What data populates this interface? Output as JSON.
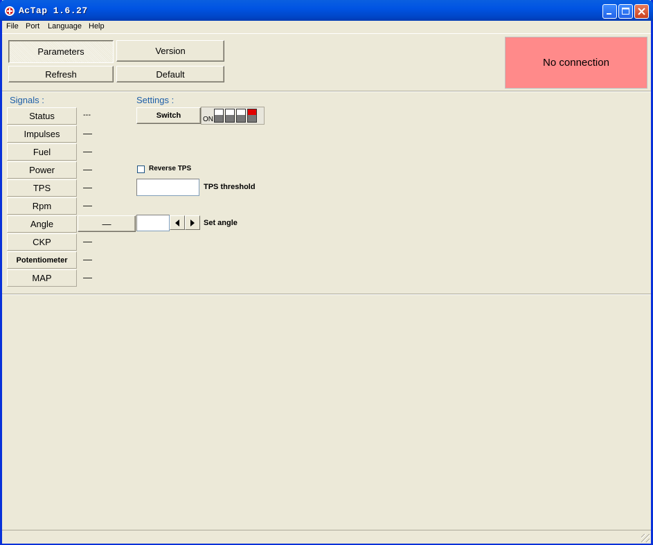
{
  "window": {
    "title": "AcTap  1.6.27"
  },
  "menu": [
    "File",
    "Port",
    "Language",
    "Help"
  ],
  "toolbar": {
    "parameters": "Parameters",
    "version": "Version",
    "refresh": "Refresh",
    "default": "Default"
  },
  "connection": {
    "status": "No connection",
    "color": "#ff8a8a"
  },
  "signals": {
    "title": "Signals :",
    "items": [
      {
        "label": "Status",
        "value": "---"
      },
      {
        "label": "Impulses",
        "value": "—"
      },
      {
        "label": "Fuel",
        "value": "—"
      },
      {
        "label": "Power",
        "value": "—"
      },
      {
        "label": "TPS",
        "value": "—"
      },
      {
        "label": "Rpm",
        "value": "—"
      },
      {
        "label": "Angle",
        "value": "—"
      },
      {
        "label": "CKP",
        "value": "—"
      },
      {
        "label": "Potentiometer",
        "value": "—"
      },
      {
        "label": "MAP",
        "value": "—"
      }
    ]
  },
  "settings": {
    "title": "Settings :",
    "switch_label": "Switch",
    "dip_label": "ON",
    "dip_states": [
      false,
      false,
      false,
      true
    ],
    "reverse_tps": "Reverse TPS",
    "tps_threshold_label": "TPS threshold",
    "tps_threshold_value": "",
    "set_angle_label": "Set angle",
    "angle_value": ""
  }
}
